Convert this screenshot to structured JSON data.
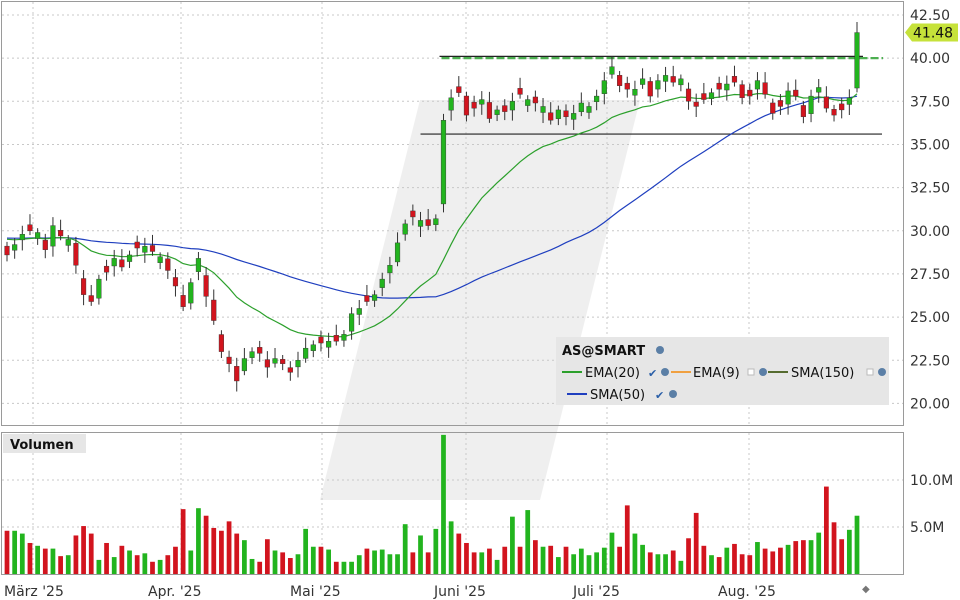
{
  "chart_data": [
    {
      "type": "candlestick",
      "symbol": "AS@SMART",
      "ylim": [
        18.75,
        43.25
      ],
      "y_ticks": [
        20.0,
        22.5,
        25.0,
        27.5,
        30.0,
        32.5,
        35.0,
        37.5,
        40.0,
        42.5
      ],
      "y_tick_labels": [
        "20.00",
        "22.50",
        "25.00",
        "27.50",
        "30.00",
        "32.50",
        "35.00",
        "37.50",
        "40.00",
        "42.50"
      ],
      "last_price": 41.48,
      "last_price_label": "41.48",
      "x_labels": [
        "März '25",
        "Apr. '25",
        "Mai '25",
        "Juni '25",
        "Juli '25",
        "Aug. '25"
      ],
      "legend": [
        {
          "name": "EMA(20)",
          "color": "#2ca02c"
        },
        {
          "name": "EMA(9)",
          "color": "#f0a040"
        },
        {
          "name": "SMA(150)",
          "color": "#556b2f"
        },
        {
          "name": "SMA(50)",
          "color": "#1f3fbf"
        }
      ],
      "horizontal_lines": [
        {
          "price": 40.1,
          "style": "solid",
          "color": "#222222"
        },
        {
          "price": 35.6,
          "style": "solid",
          "color": "#222222"
        },
        {
          "price": 40.0,
          "style": "dashed",
          "color": "#4caf50"
        }
      ],
      "close": [
        28.6,
        29.2,
        29.8,
        30.0,
        29.9,
        28.9,
        30.3,
        29.7,
        29.5,
        28.0,
        26.3,
        25.9,
        27.2,
        27.6,
        28.4,
        27.9,
        28.6,
        29.0,
        29.1,
        28.8,
        28.5,
        27.7,
        26.8,
        25.6,
        27.0,
        28.4,
        26.2,
        24.8,
        23.0,
        22.3,
        21.3,
        22.6,
        23.0,
        22.9,
        22.1,
        22.6,
        22.3,
        21.8,
        22.5,
        23.2,
        23.4,
        23.5,
        23.6,
        23.6,
        24.0,
        25.2,
        25.5,
        25.9,
        26.3,
        27.2,
        28.0,
        29.3,
        30.4,
        30.8,
        30.6,
        30.3,
        30.7,
        36.4,
        37.7,
        38.0,
        36.7,
        37.1,
        37.6,
        36.5,
        37.0,
        36.9,
        37.5,
        37.9,
        37.6,
        37.4,
        37.2,
        36.4,
        37.0,
        36.6,
        36.8,
        37.4,
        37.2,
        37.8,
        38.7,
        39.5,
        38.4,
        38.2,
        38.2,
        38.8,
        37.8,
        38.7,
        39.0,
        38.6,
        38.8,
        37.5,
        37.2,
        37.6,
        38.0,
        38.2,
        38.5,
        38.6,
        37.7,
        37.8,
        38.7,
        37.9,
        36.8,
        37.2,
        38.1,
        37.8,
        36.6,
        37.8,
        38.3,
        37.1,
        36.7,
        37.0,
        37.7,
        41.48
      ],
      "volume_ylim": [
        0,
        15000000
      ],
      "volume_ticks": [
        5000000,
        10000000
      ],
      "volume_tick_labels": [
        "5.0M",
        "10.0M"
      ],
      "volume": [
        4600000,
        4600000,
        4300000,
        3300000,
        3000000,
        2700000,
        2700000,
        1900000,
        2000000,
        4100000,
        5100000,
        4300000,
        1500000,
        3300000,
        1800000,
        3000000,
        2500000,
        2000000,
        2200000,
        1300000,
        1500000,
        2000000,
        2900000,
        6900000,
        2500000,
        7000000,
        6200000,
        4900000,
        4600000,
        5600000,
        4300000,
        3600000,
        1600000,
        1300000,
        3700000,
        2500000,
        2300000,
        1700000,
        2100000,
        4800000,
        2900000,
        2900000,
        2600000,
        1300000,
        1300000,
        1300000,
        2000000,
        2700000,
        2500000,
        2600000,
        2100000,
        2100000,
        5300000,
        2300000,
        4100000,
        2300000,
        4800000,
        14800000,
        5600000,
        4300000,
        3300000,
        2300000,
        2300000,
        2700000,
        1500000,
        2900000,
        6100000,
        2900000,
        6800000,
        3600000,
        2900000,
        3000000,
        1800000,
        2900000,
        2100000,
        2700000,
        2000000,
        2300000,
        2800000,
        4400000,
        2900000,
        7300000,
        4300000,
        3100000,
        2300000,
        2100000,
        2100000,
        2500000,
        1400000,
        3800000,
        6500000,
        3000000,
        2000000,
        1800000,
        2800000,
        3200000,
        2100000,
        2000000,
        3400000,
        2700000,
        2400000,
        2800000,
        3100000,
        3500000,
        3600000,
        3600000,
        4400000,
        9300000,
        5500000,
        3700000,
        4700000,
        6200000
      ],
      "volume_label": "Volumen"
    }
  ]
}
